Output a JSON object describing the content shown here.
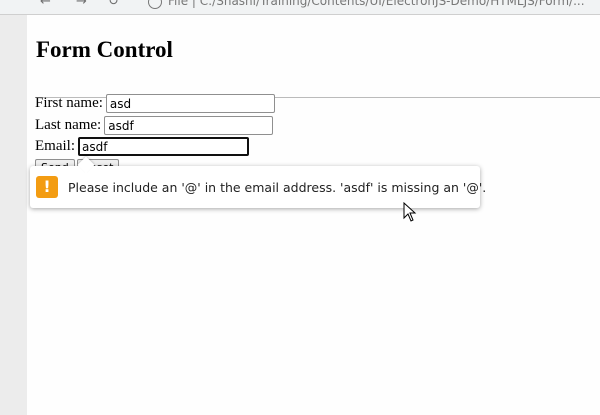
{
  "browser": {
    "address_text": "File  |  C:/Shashi/Training/Contents/UI/ElectronJS-Demo/HTMLJS/Form/..."
  },
  "page": {
    "title": "Form Control"
  },
  "form": {
    "first_name": {
      "label": "First name:",
      "value": "asd"
    },
    "last_name": {
      "label": "Last name:",
      "value": "asdf"
    },
    "email": {
      "label": "Email:",
      "value": "asdf"
    },
    "send_label": "Send",
    "reset_label": "Reset"
  },
  "validation": {
    "message": "Please include an '@' in the email address. 'asdf' is missing an '@'.",
    "icon": "warning-icon",
    "color": "#f39c12"
  }
}
